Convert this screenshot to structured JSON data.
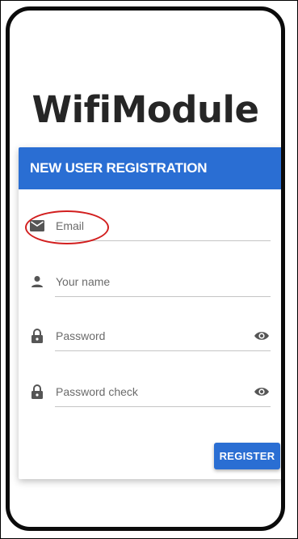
{
  "app": {
    "title": "WifiModule"
  },
  "card": {
    "header": "NEW USER REGISTRATION"
  },
  "fields": {
    "email": {
      "placeholder": "Email",
      "icon": "mail-icon"
    },
    "name": {
      "placeholder": "Your name",
      "icon": "person-icon"
    },
    "password": {
      "placeholder": "Password",
      "icon": "lock-icon",
      "toggle_icon": "eye-icon"
    },
    "password_check": {
      "placeholder": "Password check",
      "icon": "lock-icon",
      "toggle_icon": "eye-icon"
    }
  },
  "actions": {
    "register_label": "REGISTER"
  },
  "colors": {
    "primary": "#2a6ed3",
    "highlight": "#d21f1f",
    "title_text": "#262626"
  }
}
